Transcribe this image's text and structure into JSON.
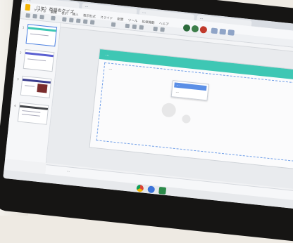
{
  "browser": {
    "tabs": [
      {
        "title": "…"
      },
      {
        "title": "…"
      },
      {
        "title": "…"
      },
      {
        "title": "…"
      }
    ]
  },
  "app": {
    "doc_title": "（1年）英語のクイズ",
    "menu": [
      "ファイル",
      "編集",
      "表示",
      "挿入",
      "表示形式",
      "スライド",
      "配置",
      "ツール",
      "拡張機能",
      "ヘルプ"
    ]
  },
  "filmstrip": {
    "slides": [
      {
        "number": "1",
        "band_color": "#3ec7b4",
        "selected": true
      },
      {
        "number": "2",
        "band_color": "#5a5fd1",
        "selected": false
      },
      {
        "number": "3",
        "band_color": "#3b3e8f",
        "selected": false
      },
      {
        "number": "4",
        "band_color": "#44464a",
        "selected": false
      }
    ]
  },
  "slide": {
    "band_text": "…",
    "textbox_text": "…",
    "accent_color": "#3ec7b4"
  },
  "context_menu": {
    "items": [
      {
        "label": "…"
      },
      {
        "label": "…"
      }
    ]
  },
  "notes": {
    "text": "…"
  },
  "shelf": {
    "icons": [
      "chrome-icon",
      "camera-icon",
      "files-icon"
    ]
  }
}
